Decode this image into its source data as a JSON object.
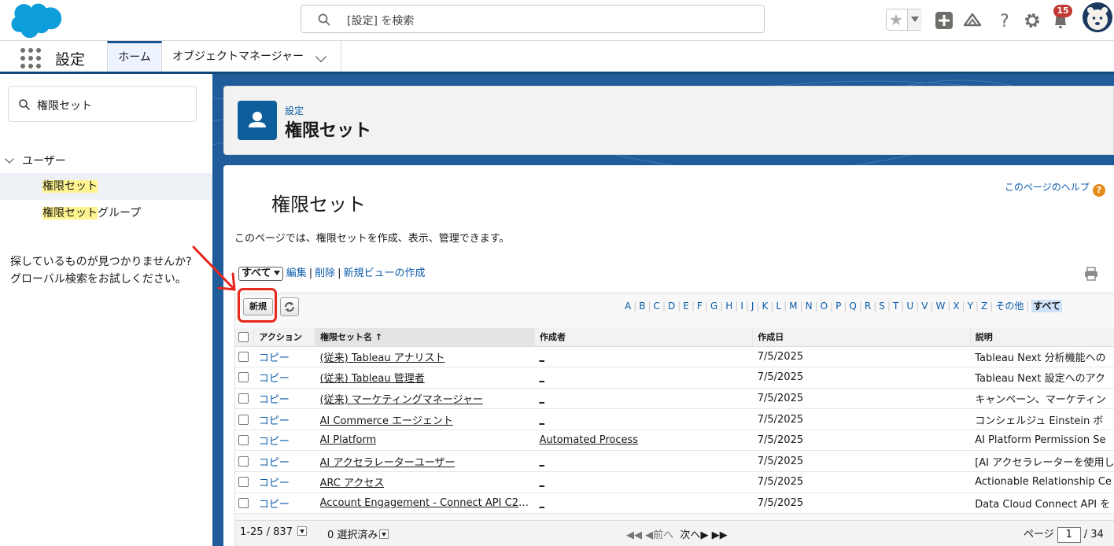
{
  "header": {
    "search_placeholder": "[設定] を検索",
    "notifications_count": "15"
  },
  "app_nav": {
    "app_name": "設定",
    "tabs": [
      {
        "label": "ホーム",
        "active": true
      },
      {
        "label": "オブジェクトマネージャー",
        "active": false
      }
    ]
  },
  "sidebar": {
    "quick_find_value": "権限セット",
    "parent": "ユーザー",
    "items": [
      {
        "highlight": "権限セット",
        "rest": "",
        "selected": true
      },
      {
        "highlight": "権限セット",
        "rest": "グループ",
        "selected": false
      }
    ],
    "tip_line1": "探しているものが見つかりませんか?",
    "tip_line2": "グローバル検索をお試しください。"
  },
  "page_header": {
    "breadcrumb": "設定",
    "title": "権限セット"
  },
  "content": {
    "heading": "権限セット",
    "help_link": "このページのヘルプ",
    "help_icon": "?",
    "description": "このページでは、権限セットを作成、表示、管理できます。",
    "view_select": "すべて",
    "view_links": {
      "edit": "編集",
      "delete": "削除",
      "create": "新規ビューの作成"
    },
    "new_button": "新規",
    "alpha_filter": [
      "A",
      "B",
      "C",
      "D",
      "E",
      "F",
      "G",
      "H",
      "I",
      "J",
      "K",
      "L",
      "M",
      "N",
      "O",
      "P",
      "Q",
      "R",
      "S",
      "T",
      "U",
      "V",
      "W",
      "X",
      "Y",
      "Z",
      "その他",
      "すべて"
    ],
    "alpha_active": "すべて",
    "columns": {
      "action": "アクション",
      "name": "権限セット名 ↑",
      "created_by": "作成者",
      "created_date": "作成日",
      "description": "説明"
    },
    "rows": [
      {
        "action": "コピー",
        "name": "(従来) Tableau アナリスト",
        "created_by": "_",
        "created_date": "7/5/2025",
        "description": "Tableau Next 分析機能への"
      },
      {
        "action": "コピー",
        "name": "(従来) Tableau 管理者",
        "created_by": "_",
        "created_date": "7/5/2025",
        "description": "Tableau Next 設定へのアク"
      },
      {
        "action": "コピー",
        "name": "(従来) マーケティングマネージャー",
        "created_by": "_",
        "created_date": "7/5/2025",
        "description": "キャンペーン、マーケティン"
      },
      {
        "action": "コピー",
        "name": "AI Commerce エージェント",
        "created_by": "_",
        "created_date": "7/5/2025",
        "description": "コンシェルジュ Einstein ボ"
      },
      {
        "action": "コピー",
        "name": "AI Platform",
        "created_by": "Automated Process",
        "created_date": "7/5/2025",
        "description": "AI Platform Permission Se"
      },
      {
        "action": "コピー",
        "name": "AI アクセラレーターユーザー",
        "created_by": "_",
        "created_date": "7/5/2025",
        "description": "[AI アクセラレーターを使用し"
      },
      {
        "action": "コピー",
        "name": "ARC アクセス",
        "created_by": "_",
        "created_date": "7/5/2025",
        "description": "Actionable Relationship Ce"
      },
      {
        "action": "コピー",
        "name": "Account Engagement - Connect API C2C…",
        "created_by": "_",
        "created_date": "7/5/2025",
        "description": "Data Cloud Connect API を"
      }
    ],
    "pager": {
      "range": "1-25 / 837",
      "selected": "0 選択済み",
      "prev": "前へ",
      "next": "次へ",
      "page_label": "ページ",
      "page_value": "1",
      "page_total": "/ 34"
    }
  },
  "colors": {
    "brand_blue": "#0b5cab",
    "nav_bar": "#0f4a7a",
    "annotation_red": "#e8271d",
    "badge_red": "#c23934",
    "highlight_yellow": "#fff48f"
  }
}
